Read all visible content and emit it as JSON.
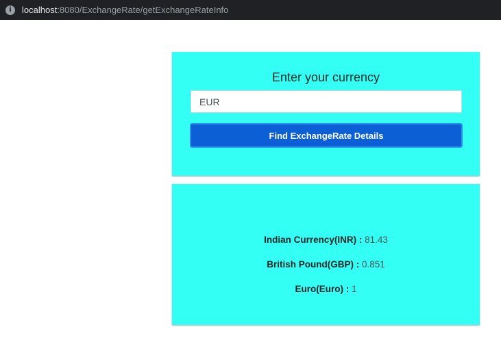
{
  "browser": {
    "url_host": "localhost",
    "url_path": ":8080/ExchangeRate/getExchangeRateInfo"
  },
  "form_card": {
    "title": "Enter your currency",
    "input_value": "EUR",
    "button_label": "Find ExchangeRate Details"
  },
  "result_card": {
    "rates": [
      {
        "label": "Indian Currency(INR) :",
        "value": "81.43"
      },
      {
        "label": "British Pound(GBP) :",
        "value": "0.851"
      },
      {
        "label": "Euro(Euro) :",
        "value": "1"
      }
    ]
  },
  "colors": {
    "card_background": "#33fff5",
    "button_background": "#0d5fd6",
    "address_bar": "#202124"
  }
}
